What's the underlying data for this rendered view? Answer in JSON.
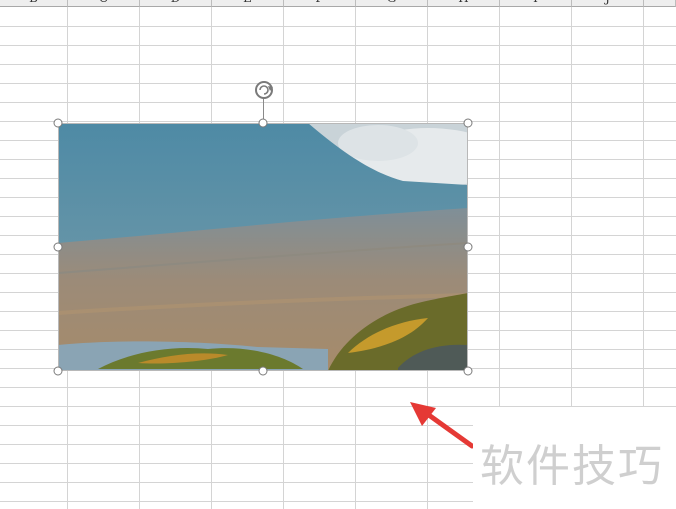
{
  "sheet": {
    "columns": [
      "B",
      "C",
      "D",
      "E",
      "F",
      "G",
      "H",
      "I",
      "J",
      ""
    ],
    "colors": {
      "grid": "#d4d4d4",
      "header_bg": "#eeeeee"
    }
  },
  "picture": {
    "description_icon": "landscape-photo",
    "selected": true
  },
  "annotation": {
    "arrow_color": "#e53935",
    "watermark": "软件技巧"
  }
}
